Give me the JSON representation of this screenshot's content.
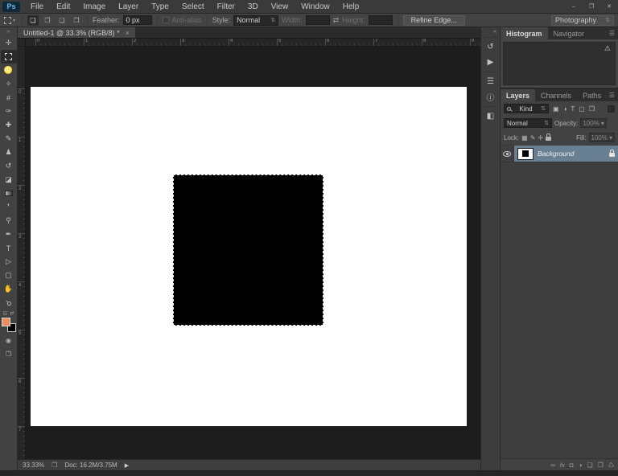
{
  "window": {
    "minimize": "–",
    "restore": "❐",
    "close": "✕"
  },
  "menubar": {
    "logo": "Ps",
    "items": [
      {
        "label": "File"
      },
      {
        "label": "Edit"
      },
      {
        "label": "Image"
      },
      {
        "label": "Layer"
      },
      {
        "label": "Type"
      },
      {
        "label": "Select"
      },
      {
        "label": "Filter"
      },
      {
        "label": "3D"
      },
      {
        "label": "View"
      },
      {
        "label": "Window"
      },
      {
        "label": "Help"
      }
    ]
  },
  "options_bar": {
    "modes": [
      {
        "name": "new-selection",
        "glyph": "❏"
      },
      {
        "name": "add-to-selection",
        "glyph": "❐"
      },
      {
        "name": "subtract-from-selection",
        "glyph": "❑"
      },
      {
        "name": "intersect-selection",
        "glyph": "❒"
      }
    ],
    "feather_label": "Feather:",
    "feather_value": "0 px",
    "antialias_label": "Anti-alias",
    "style_label": "Style:",
    "style_value": "Normal",
    "width_label": "Width:",
    "width_value": "",
    "swap_glyph": "⇄",
    "height_label": "Height:",
    "height_value": "",
    "refine_edge_label": "Refine Edge...",
    "workspace_value": "Photography"
  },
  "document_tab": {
    "title": "Untitled-1 @ 33.3% (RGB/8) *",
    "close_glyph": "×"
  },
  "toolbar": {
    "collapse_glyph": "»",
    "tools": [
      {
        "name": "move-tool",
        "glyph": "✛"
      },
      {
        "name": "rectangular-marquee-tool",
        "glyph": ""
      },
      {
        "name": "lasso-tool",
        "glyph": "♌"
      },
      {
        "name": "quick-selection-tool",
        "glyph": "✧"
      },
      {
        "name": "crop-tool",
        "glyph": "#"
      },
      {
        "name": "eyedropper-tool",
        "glyph": "✑"
      },
      {
        "name": "healing-brush-tool",
        "glyph": "✚"
      },
      {
        "name": "brush-tool",
        "glyph": "✎"
      },
      {
        "name": "clone-stamp-tool",
        "glyph": "♟"
      },
      {
        "name": "history-brush-tool",
        "glyph": "↺"
      },
      {
        "name": "eraser-tool",
        "glyph": "◪"
      },
      {
        "name": "gradient-tool",
        "glyph": ""
      },
      {
        "name": "blur-tool",
        "glyph": "❜"
      },
      {
        "name": "dodge-tool",
        "glyph": "⚲"
      },
      {
        "name": "pen-tool",
        "glyph": "✒"
      },
      {
        "name": "type-tool",
        "glyph": "T"
      },
      {
        "name": "path-selection-tool",
        "glyph": "▷"
      },
      {
        "name": "rectangle-tool",
        "glyph": "▢"
      },
      {
        "name": "hand-tool",
        "glyph": "✋"
      },
      {
        "name": "zoom-tool",
        "glyph": "⚲"
      }
    ],
    "default_colors_glyph": "◱",
    "swap_colors_glyph": "⇄",
    "foreground_color": "#ee8e60",
    "background_color": "#000000",
    "quick_mask_glyph": "◉",
    "screen_mode_glyph": "❐"
  },
  "rulers": {
    "horizontal": [
      "0",
      "1",
      "2",
      "3",
      "4",
      "5",
      "6",
      "7",
      "8",
      "9"
    ],
    "vertical": [
      "0",
      "1",
      "2",
      "3",
      "4",
      "5",
      "6",
      "7"
    ]
  },
  "canvas": {
    "background": "#ffffff",
    "square_color": "#000000"
  },
  "dock_strip": {
    "collapse_glyph": "«",
    "icons": [
      {
        "name": "history",
        "glyph": "↺"
      },
      {
        "name": "actions",
        "glyph": "▶"
      },
      {
        "name": "adjustments",
        "glyph": "☰"
      },
      {
        "name": "info",
        "glyph": "ⓘ"
      },
      {
        "name": "properties",
        "glyph": "◧"
      }
    ]
  },
  "histogram_panel": {
    "tabs": [
      {
        "label": "Histogram"
      },
      {
        "label": "Navigator"
      }
    ],
    "menu_glyph": "☰",
    "warning_glyph": "⚠"
  },
  "layers_panel": {
    "tabs": [
      {
        "label": "Layers"
      },
      {
        "label": "Channels"
      },
      {
        "label": "Paths"
      }
    ],
    "menu_glyph": "☰",
    "kind_label": "Kind",
    "kind_updown": "⇅",
    "type_icons": [
      {
        "name": "filter-pixel-layers",
        "glyph": "▣"
      },
      {
        "name": "filter-adjustment-layers",
        "glyph": "◑"
      },
      {
        "name": "filter-type-layers",
        "glyph": "T"
      },
      {
        "name": "filter-shape-layers",
        "glyph": "▢"
      },
      {
        "name": "filter-smart-objects",
        "glyph": "❒"
      }
    ],
    "blend_mode": "Normal",
    "blend_updown": "⇅",
    "opacity_label": "Opacity:",
    "opacity_value": "100%",
    "lock_label": "Lock:",
    "lock_icons": [
      {
        "name": "lock-transparent-pixels",
        "glyph": "▦"
      },
      {
        "name": "lock-image-pixels",
        "glyph": "✎"
      },
      {
        "name": "lock-position",
        "glyph": "✛"
      }
    ],
    "fill_label": "Fill:",
    "fill_value": "100%",
    "value_arrow": "▾",
    "layer": {
      "name": "Background"
    },
    "selected_color": "#697f92",
    "footer_icons": [
      {
        "name": "link-layers",
        "glyph": "∞"
      },
      {
        "name": "layer-effects",
        "glyph": "fx"
      },
      {
        "name": "add-layer-mask",
        "glyph": "◘"
      },
      {
        "name": "new-adjustment-layer",
        "glyph": "◑"
      },
      {
        "name": "new-group",
        "glyph": "❏"
      },
      {
        "name": "new-layer",
        "glyph": "❐"
      },
      {
        "name": "delete-layer",
        "glyph": "♺"
      }
    ]
  },
  "status_bar": {
    "zoom": "33.33%",
    "scratch_glyph": "❒",
    "doc_info": "Doc: 16.2M/3.75M",
    "arrow_glyph": "▶"
  }
}
